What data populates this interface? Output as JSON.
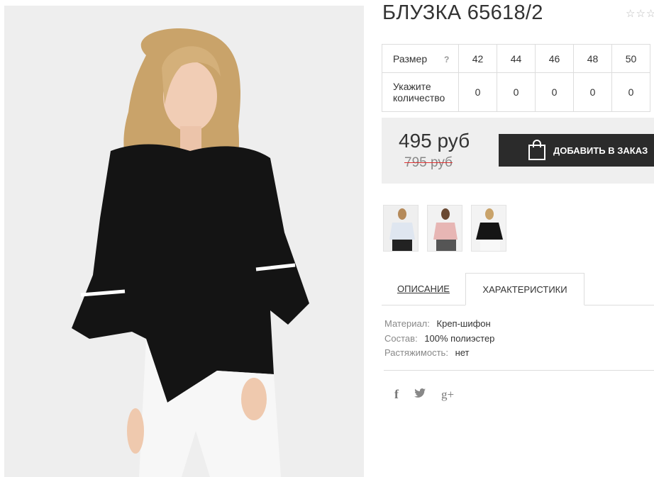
{
  "product": {
    "title": "БЛУЗКА 65618/2",
    "rating_stars": "☆☆☆"
  },
  "sizes_table": {
    "size_label": "Размер",
    "help_icon": "?",
    "sizes": [
      "42",
      "44",
      "46",
      "48",
      "50"
    ],
    "qty_label_line1": "Укажите",
    "qty_label_line2": "количество",
    "quantities": [
      "0",
      "0",
      "0",
      "0",
      "0"
    ]
  },
  "pricing": {
    "price": "495 руб",
    "old_price": "795 руб",
    "add_button_label": "ДОБАВИТЬ В ЗАКАЗ",
    "button_icon": "shopping-bag-icon"
  },
  "thumbnails": [
    "blouse-white-thumbnail",
    "blouse-pink-thumbnail",
    "blouse-black-thumbnail"
  ],
  "tabs": {
    "description": "ОПИСАНИЕ",
    "characteristics": "ХАРАКТЕРИСТИКИ",
    "active": "characteristics"
  },
  "characteristics": [
    {
      "key": "Материал:",
      "value": "Креп-шифон"
    },
    {
      "key": "Состав:",
      "value": "100% полиэстер"
    },
    {
      "key": "Растяжимость:",
      "value": "нет"
    }
  ],
  "social": {
    "facebook": "f",
    "twitter_icon": "twitter-icon",
    "googleplus": "g+"
  },
  "colors": {
    "accent_dark": "#2b2b2b",
    "strike_red": "#e03030",
    "panel_bg": "#efefef"
  }
}
